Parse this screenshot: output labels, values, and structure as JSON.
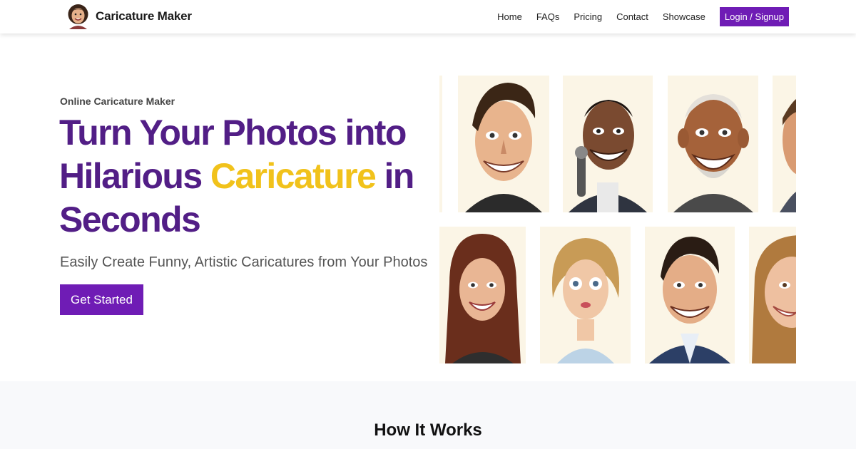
{
  "nav": {
    "brand": "Caricature Maker",
    "links": [
      "Home",
      "FAQs",
      "Pricing",
      "Contact",
      "Showcase"
    ],
    "cta": "Login / Signup"
  },
  "hero": {
    "eyebrow": "Online Caricature Maker",
    "title_pre": "Turn Your Photos into Hilarious ",
    "title_highlight": "Caricature",
    "title_post": " in Seconds",
    "subtitle": "Easily Create Funny, Artistic Caricatures from Your Photos",
    "cta": "Get Started"
  },
  "gallery": {
    "row1": [
      "caricature-man-dark-hair",
      "caricature-man-microphone",
      "caricature-old-man-beard",
      "caricature-partial"
    ],
    "row2": [
      "caricature-woman-long-hair",
      "caricature-woman-blonde",
      "caricature-man-suit",
      "caricature-woman-partial"
    ]
  },
  "how_it_works": {
    "title": "How It Works"
  },
  "colors": {
    "primary": "#6f1cb5",
    "title": "#521e86",
    "highlight": "#f1c21b",
    "card_bg": "#fbf5e6",
    "section_bg": "#f8f9fb"
  }
}
